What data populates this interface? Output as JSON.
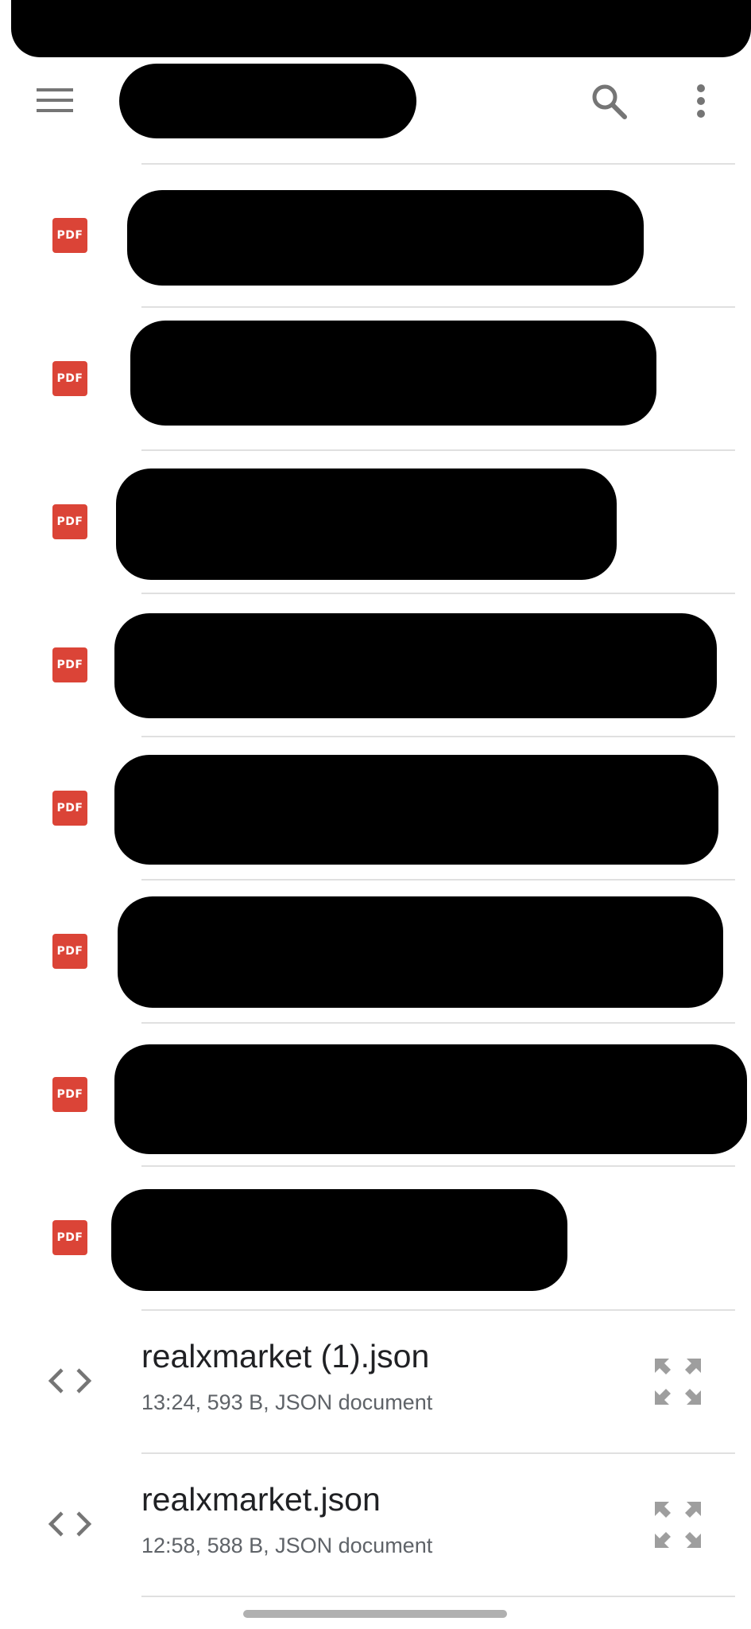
{
  "toolbar": {
    "menu_icon": "hamburger-menu-icon",
    "search_icon": "search-icon",
    "more_icon": "more-vert-icon"
  },
  "files": [
    {
      "type_badge": "PDF",
      "icon": "pdf-icon"
    },
    {
      "type_badge": "PDF",
      "icon": "pdf-icon"
    },
    {
      "type_badge": "PDF",
      "icon": "pdf-icon"
    },
    {
      "type_badge": "PDF",
      "icon": "pdf-icon"
    },
    {
      "type_badge": "PDF",
      "icon": "pdf-icon"
    },
    {
      "type_badge": "PDF",
      "icon": "pdf-icon"
    },
    {
      "type_badge": "PDF",
      "icon": "pdf-icon"
    },
    {
      "type_badge": "PDF",
      "icon": "pdf-icon"
    },
    {
      "name": "realxmarket (1).json",
      "meta": "13:24, 593 B, JSON document",
      "icon": "code-icon",
      "action_icon": "expand-icon"
    },
    {
      "name": "realxmarket.json",
      "meta": "12:58, 588 B, JSON document",
      "icon": "code-icon",
      "action_icon": "expand-icon"
    }
  ],
  "colors": {
    "pdf_red": "#db4437",
    "icon_gray": "#757575",
    "divider": "#e0e0e0",
    "meta_text": "#5f6368"
  }
}
